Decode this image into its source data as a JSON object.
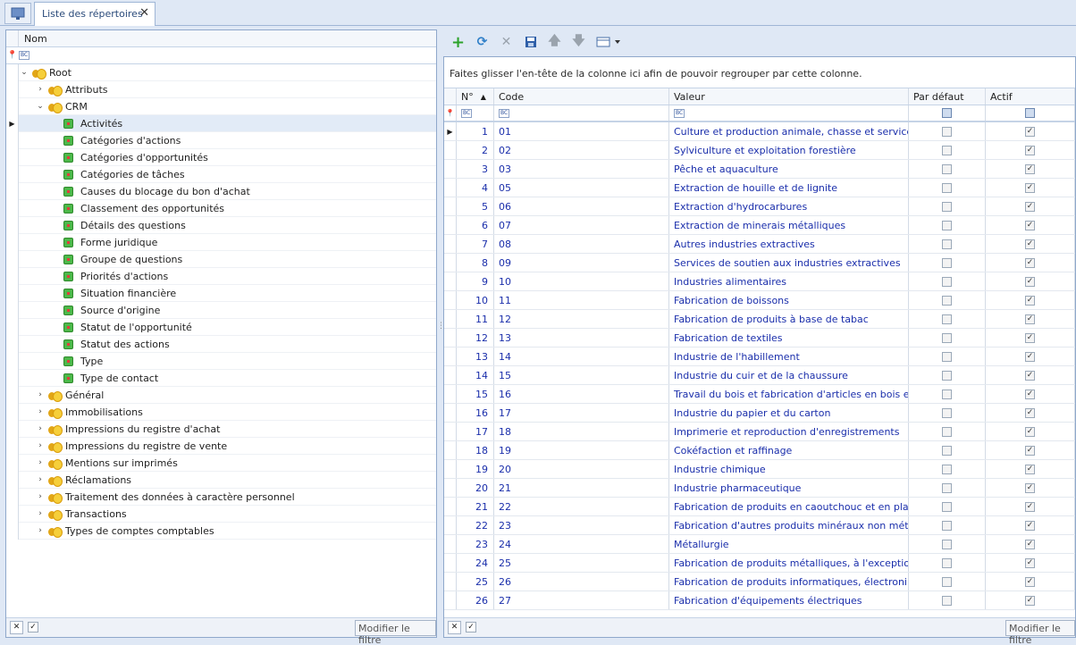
{
  "tab": {
    "title": "Liste des répertoires",
    "close": "✕"
  },
  "tree": {
    "header": "Nom",
    "filter_icon": "BC",
    "root": "Root",
    "items": [
      {
        "label": "Attributs",
        "level": 1,
        "type": "folder",
        "expanded": false
      },
      {
        "label": "CRM",
        "level": 1,
        "type": "folder",
        "expanded": true
      },
      {
        "label": "Activités",
        "level": 2,
        "type": "leaf",
        "selected": true
      },
      {
        "label": "Catégories d'actions",
        "level": 2,
        "type": "leaf"
      },
      {
        "label": "Catégories d'opportunités",
        "level": 2,
        "type": "leaf"
      },
      {
        "label": "Catégories de tâches",
        "level": 2,
        "type": "leaf"
      },
      {
        "label": "Causes du blocage du bon d'achat",
        "level": 2,
        "type": "leaf"
      },
      {
        "label": "Classement des opportunités",
        "level": 2,
        "type": "leaf"
      },
      {
        "label": "Détails des questions",
        "level": 2,
        "type": "leaf"
      },
      {
        "label": "Forme juridique",
        "level": 2,
        "type": "leaf"
      },
      {
        "label": "Groupe de questions",
        "level": 2,
        "type": "leaf"
      },
      {
        "label": "Priorités d'actions",
        "level": 2,
        "type": "leaf"
      },
      {
        "label": "Situation financière",
        "level": 2,
        "type": "leaf"
      },
      {
        "label": "Source d'origine",
        "level": 2,
        "type": "leaf"
      },
      {
        "label": "Statut de l'opportunité",
        "level": 2,
        "type": "leaf"
      },
      {
        "label": "Statut des actions",
        "level": 2,
        "type": "leaf"
      },
      {
        "label": "Type",
        "level": 2,
        "type": "leaf"
      },
      {
        "label": "Type de contact",
        "level": 2,
        "type": "leaf"
      },
      {
        "label": "Général",
        "level": 1,
        "type": "folder",
        "expanded": false
      },
      {
        "label": "Immobilisations",
        "level": 1,
        "type": "folder",
        "expanded": false
      },
      {
        "label": "Impressions du registre d'achat",
        "level": 1,
        "type": "folder",
        "expanded": false
      },
      {
        "label": "Impressions du registre de vente",
        "level": 1,
        "type": "folder",
        "expanded": false
      },
      {
        "label": "Mentions sur imprimés",
        "level": 1,
        "type": "folder",
        "expanded": false
      },
      {
        "label": "Réclamations",
        "level": 1,
        "type": "folder",
        "expanded": false
      },
      {
        "label": "Traitement des données à caractère personnel",
        "level": 1,
        "type": "folder",
        "expanded": false
      },
      {
        "label": "Transactions",
        "level": 1,
        "type": "folder",
        "expanded": false
      },
      {
        "label": "Types de comptes comptables",
        "level": 1,
        "type": "folder",
        "expanded": false
      }
    ],
    "footer_button": "Modifier le filtre"
  },
  "toolbar": {
    "icons": [
      "add-icon",
      "refresh-icon",
      "delete-icon",
      "save-icon",
      "move-up-icon",
      "move-down-icon",
      "view-options-icon"
    ]
  },
  "grid": {
    "grouping_hint": "Faites glisser l'en-tête de la colonne ici afin de pouvoir regrouper par cette colonne.",
    "columns": [
      "N°",
      "Code",
      "Valeur",
      "Par défaut",
      "Actif"
    ],
    "filter_icon": "BC",
    "rows": [
      {
        "n": "1",
        "code": "01",
        "valeur": "Culture et production animale, chasse et services...",
        "defaut": false,
        "actif": true
      },
      {
        "n": "2",
        "code": "02",
        "valeur": "Sylviculture et exploitation forestière",
        "defaut": false,
        "actif": true
      },
      {
        "n": "3",
        "code": "03",
        "valeur": "Pêche et aquaculture",
        "defaut": false,
        "actif": true
      },
      {
        "n": "4",
        "code": "05",
        "valeur": "Extraction de houille et de lignite",
        "defaut": false,
        "actif": true
      },
      {
        "n": "5",
        "code": "06",
        "valeur": "Extraction d'hydrocarbures",
        "defaut": false,
        "actif": true
      },
      {
        "n": "6",
        "code": "07",
        "valeur": "Extraction de minerais métalliques",
        "defaut": false,
        "actif": true
      },
      {
        "n": "7",
        "code": "08",
        "valeur": "Autres industries extractives",
        "defaut": false,
        "actif": true
      },
      {
        "n": "8",
        "code": "09",
        "valeur": "Services de soutien aux industries extractives",
        "defaut": false,
        "actif": true
      },
      {
        "n": "9",
        "code": "10",
        "valeur": "Industries alimentaires",
        "defaut": false,
        "actif": true
      },
      {
        "n": "10",
        "code": "11",
        "valeur": "Fabrication de boissons",
        "defaut": false,
        "actif": true
      },
      {
        "n": "11",
        "code": "12",
        "valeur": "Fabrication de produits à base de tabac",
        "defaut": false,
        "actif": true
      },
      {
        "n": "12",
        "code": "13",
        "valeur": "Fabrication de textiles",
        "defaut": false,
        "actif": true
      },
      {
        "n": "13",
        "code": "14",
        "valeur": "Industrie de l'habillement",
        "defaut": false,
        "actif": true
      },
      {
        "n": "14",
        "code": "15",
        "valeur": "Industrie du cuir et de la chaussure",
        "defaut": false,
        "actif": true
      },
      {
        "n": "15",
        "code": "16",
        "valeur": "Travail du bois et fabrication d'articles en bois et...",
        "defaut": false,
        "actif": true
      },
      {
        "n": "16",
        "code": "17",
        "valeur": "Industrie du papier et du carton",
        "defaut": false,
        "actif": true
      },
      {
        "n": "17",
        "code": "18",
        "valeur": "Imprimerie et reproduction d'enregistrements",
        "defaut": false,
        "actif": true
      },
      {
        "n": "18",
        "code": "19",
        "valeur": "Cokéfaction et raffinage",
        "defaut": false,
        "actif": true
      },
      {
        "n": "19",
        "code": "20",
        "valeur": "Industrie chimique",
        "defaut": false,
        "actif": true
      },
      {
        "n": "20",
        "code": "21",
        "valeur": "Industrie pharmaceutique",
        "defaut": false,
        "actif": true
      },
      {
        "n": "21",
        "code": "22",
        "valeur": "Fabrication de produits en caoutchouc et en pla...",
        "defaut": false,
        "actif": true
      },
      {
        "n": "22",
        "code": "23",
        "valeur": "Fabrication d'autres produits minéraux non mét...",
        "defaut": false,
        "actif": true
      },
      {
        "n": "23",
        "code": "24",
        "valeur": "Métallurgie",
        "defaut": false,
        "actif": true
      },
      {
        "n": "24",
        "code": "25",
        "valeur": "Fabrication de produits métalliques, à l'exceptio...",
        "defaut": false,
        "actif": true
      },
      {
        "n": "25",
        "code": "26",
        "valeur": "Fabrication de produits informatiques, électroni...",
        "defaut": false,
        "actif": true
      },
      {
        "n": "26",
        "code": "27",
        "valeur": "Fabrication d'équipements électriques",
        "defaut": false,
        "actif": true
      }
    ],
    "footer_button": "Modifier le filtre"
  }
}
